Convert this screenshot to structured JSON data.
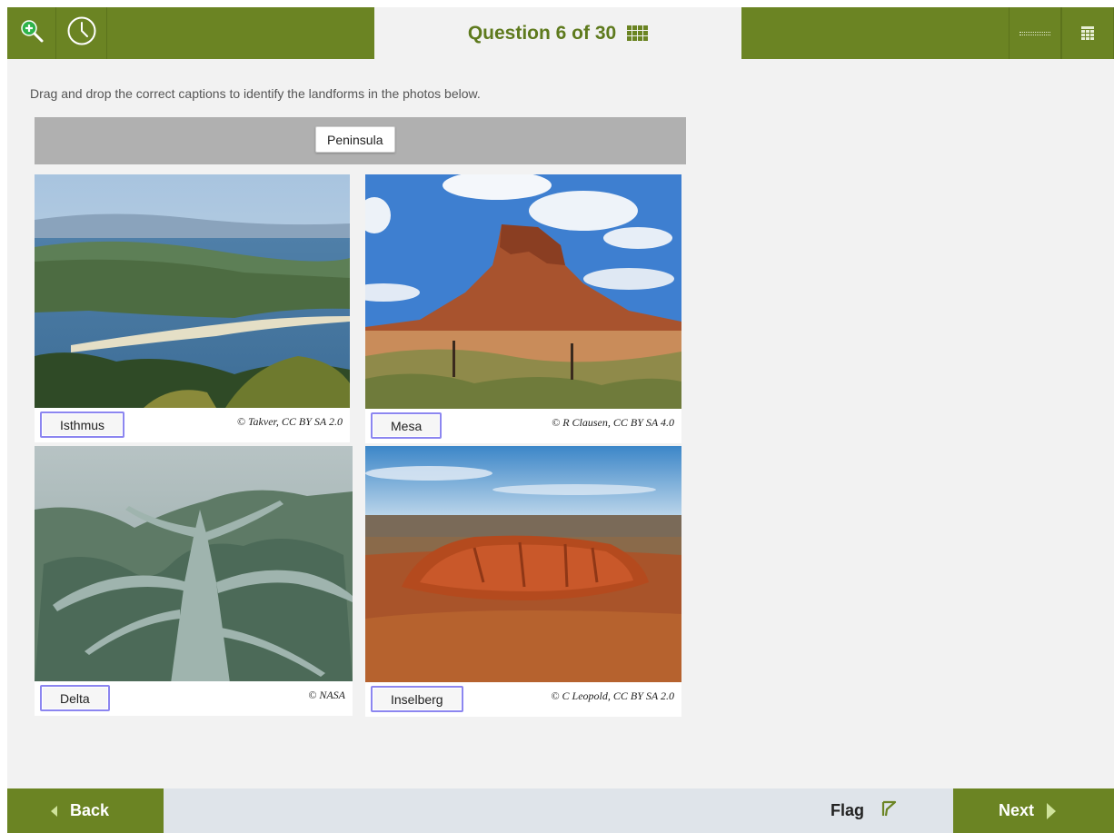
{
  "header": {
    "question_title": "Question 6 of 30",
    "icons": {
      "zoom": "zoom-in-icon",
      "timer": "clock-icon",
      "grid": "question-grid-icon",
      "ruler": "ruler-icon",
      "calculator": "calculator-icon"
    }
  },
  "instructions": "Drag and drop the correct captions to identify the landforms in the photos below.",
  "caption_bank": {
    "items": [
      "Peninsula"
    ]
  },
  "photos": [
    {
      "subject": "isthmus landscape photo",
      "caption": "Isthmus",
      "credit": "© Takver, CC BY SA 2.0"
    },
    {
      "subject": "mesa desert photo",
      "caption": "Mesa",
      "credit": "© R Clausen, CC BY SA 4.0"
    },
    {
      "subject": "river delta aerial photo",
      "caption": "Delta",
      "credit": "© NASA"
    },
    {
      "subject": "inselberg red rock photo",
      "caption": "Inselberg",
      "credit": "© C Leopold, CC BY SA 2.0"
    }
  ],
  "footer": {
    "back_label": "Back",
    "flag_label": "Flag",
    "next_label": "Next"
  },
  "colors": {
    "accent": "#6b8423",
    "drop_border": "#8c86f0",
    "bank_background": "#b0b0b0"
  }
}
